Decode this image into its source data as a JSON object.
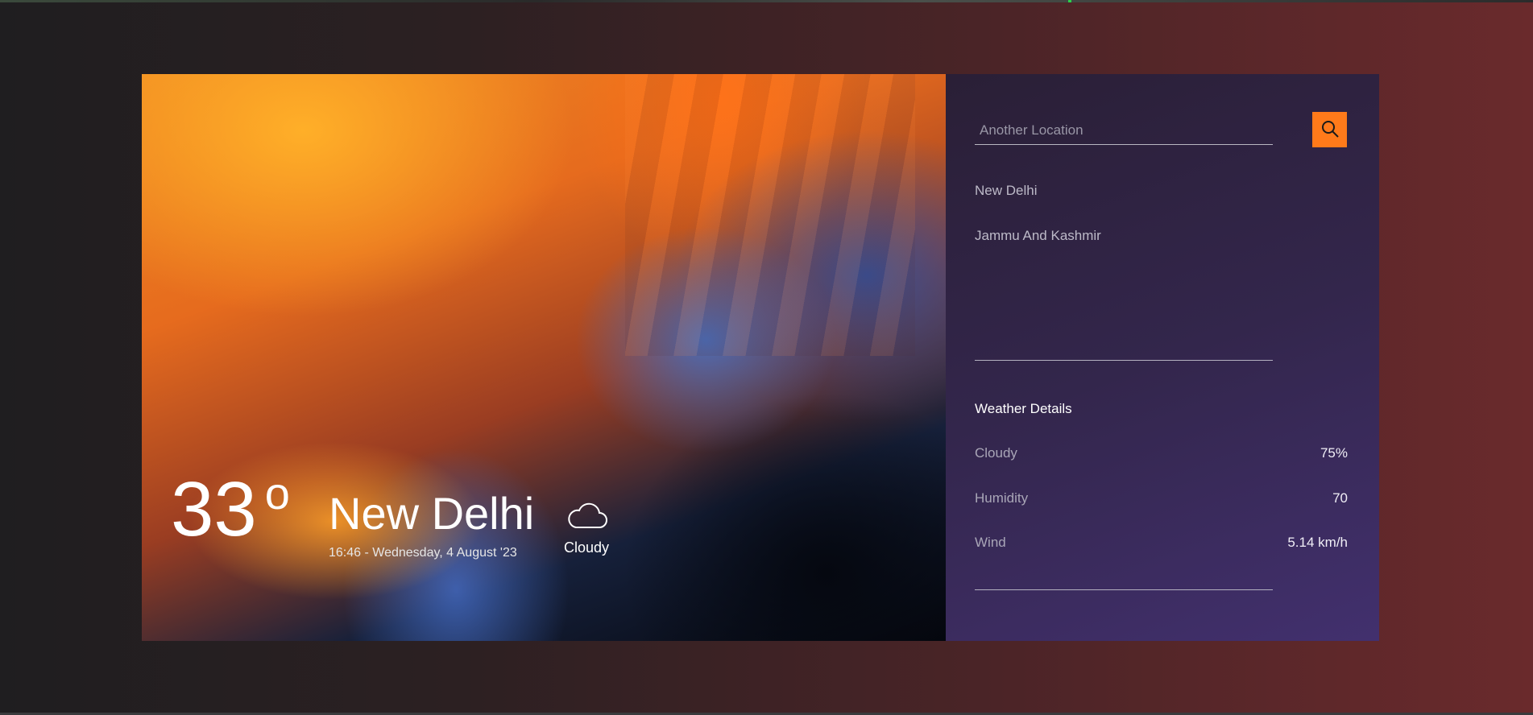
{
  "current": {
    "temperature": "33",
    "degree_symbol": "o",
    "city": "New Delhi",
    "datetime": "16:46 - Wednesday, 4 August '23",
    "condition": "Cloudy",
    "condition_icon": "cloud-icon"
  },
  "search": {
    "placeholder": "Another Location",
    "button_icon": "search-icon",
    "button_color": "#ff7a1a"
  },
  "locations": [
    "New Delhi",
    "Jammu And Kashmir"
  ],
  "details": {
    "title": "Weather Details",
    "rows": [
      {
        "label": "Cloudy",
        "value": "75%"
      },
      {
        "label": "Humidity",
        "value": "70"
      },
      {
        "label": "Wind",
        "value": "5.14 km/h"
      }
    ]
  }
}
